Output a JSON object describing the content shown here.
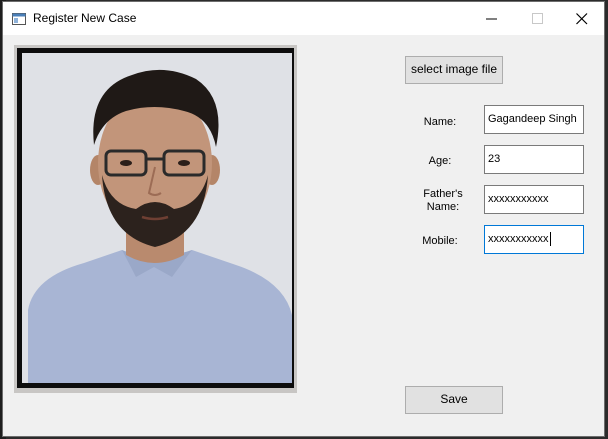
{
  "window": {
    "title": "Register New Case"
  },
  "photo": {
    "icon": "person-photo"
  },
  "actions": {
    "select_image_label": "select image file",
    "save_label": "Save"
  },
  "form": {
    "name_label": "Name:",
    "name_value": "Gagandeep Singh",
    "age_label": "Age:",
    "age_value": "23",
    "father_label_line1": "Father's",
    "father_label_line2": "Name:",
    "father_value": "xxxxxxxxxxx",
    "mobile_label": "Mobile:",
    "mobile_value": "xxxxxxxxxxx"
  },
  "colors": {
    "focus_border": "#0078d7",
    "shirt": "#a9b7d6"
  }
}
